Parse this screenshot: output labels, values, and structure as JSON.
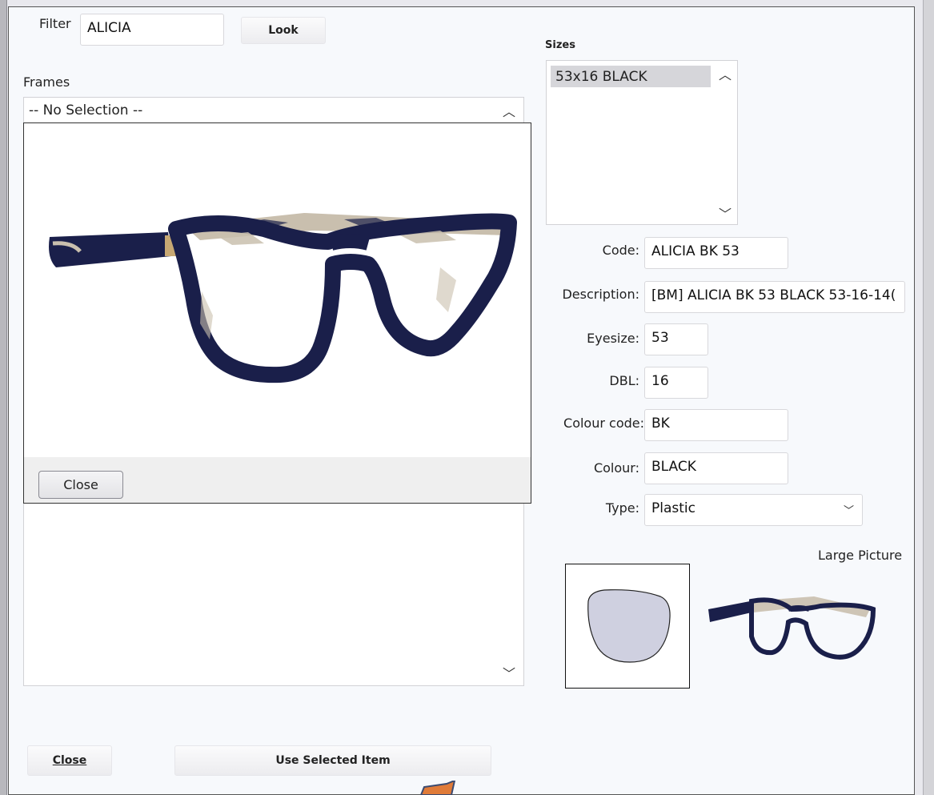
{
  "filter": {
    "label": "Filter",
    "value": "ALICIA",
    "look_button": "Look"
  },
  "frames": {
    "label": "Frames",
    "first_item": "-- No Selection --"
  },
  "popup": {
    "close_button": "Close"
  },
  "sizes": {
    "label": "Sizes",
    "items": [
      "53x16 BLACK"
    ]
  },
  "fields": {
    "code": {
      "label": "Code:",
      "value": "ALICIA BK 53"
    },
    "description": {
      "label": "Description:",
      "value": "[BM] ALICIA BK 53 BLACK 53-16-14("
    },
    "eyesize": {
      "label": "Eyesize:",
      "value": "53"
    },
    "dbl": {
      "label": "DBL:",
      "value": "16"
    },
    "colour_code": {
      "label": "Colour code:",
      "value": "BK"
    },
    "colour": {
      "label": "Colour:",
      "value": "BLACK"
    },
    "type": {
      "label": "Type:",
      "value": "Plastic"
    }
  },
  "large_picture_label": "Large Picture",
  "bottom": {
    "close_button": "Close",
    "use_selected_button": "Use Selected Item"
  },
  "colors": {
    "frame_navy": "#1a1f4a",
    "tortoise": "#c9bfae",
    "lens_shape_fill": "#cfd0e0",
    "accent_arrow": "#e07b39"
  },
  "icons": [
    "chevron-up-icon",
    "chevron-down-icon",
    "lens-shape-icon",
    "glasses-image",
    "pointer-arrow-icon"
  ]
}
